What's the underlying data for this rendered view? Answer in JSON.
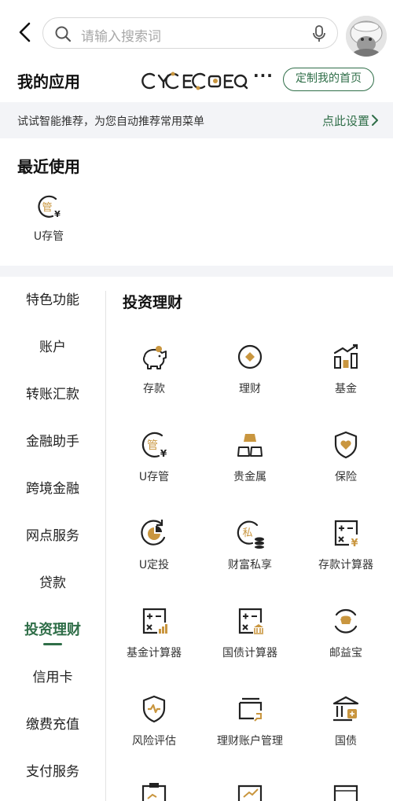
{
  "header": {
    "search_placeholder": "请输入搜索词",
    "icons": [
      "back-arrow-icon",
      "search-icon",
      "microphone-icon",
      "avatar"
    ]
  },
  "my_apps": {
    "title": "我的应用",
    "more": "···",
    "custom_button": "定制我的首页"
  },
  "suggestion": {
    "text": "试试智能推荐，为您自动推荐常用菜单",
    "link": "点此设置"
  },
  "recent": {
    "title": "最近使用",
    "items": [
      {
        "label": "U存管",
        "icon": "u-custody-icon"
      }
    ]
  },
  "sidebar": {
    "items": [
      {
        "label": "特色功能"
      },
      {
        "label": "账户"
      },
      {
        "label": "转账汇款"
      },
      {
        "label": "金融助手"
      },
      {
        "label": "跨境金融"
      },
      {
        "label": "网点服务"
      },
      {
        "label": "贷款"
      },
      {
        "label": "投资理财",
        "active": true
      },
      {
        "label": "信用卡"
      },
      {
        "label": "缴费充值"
      },
      {
        "label": "支付服务"
      }
    ]
  },
  "content": {
    "section_title": "投资理财",
    "items": [
      {
        "label": "存款",
        "icon": "piggy-bank-icon"
      },
      {
        "label": "理财",
        "icon": "wealth-coin-icon"
      },
      {
        "label": "基金",
        "icon": "fund-chart-icon"
      },
      {
        "label": "U存管",
        "icon": "u-custody-icon"
      },
      {
        "label": "贵金属",
        "icon": "gold-bars-icon"
      },
      {
        "label": "保险",
        "icon": "insurance-shield-icon"
      },
      {
        "label": "U定投",
        "icon": "fixed-investment-icon"
      },
      {
        "label": "财富私享",
        "icon": "private-wealth-icon"
      },
      {
        "label": "存款计算器",
        "icon": "deposit-calculator-icon"
      },
      {
        "label": "基金计算器",
        "icon": "fund-calculator-icon"
      },
      {
        "label": "国债计算器",
        "icon": "bond-calculator-icon"
      },
      {
        "label": "邮益宝",
        "icon": "youyibao-icon"
      },
      {
        "label": "风险评估",
        "icon": "risk-assessment-icon"
      },
      {
        "label": "理财账户管理",
        "icon": "account-management-icon"
      },
      {
        "label": "国债",
        "icon": "treasury-bond-icon"
      }
    ]
  },
  "colors": {
    "brand_green": "#2f6e48",
    "accent_gold": "#c9963f",
    "dark": "#222222",
    "panel_gray": "#f3f4f7"
  }
}
